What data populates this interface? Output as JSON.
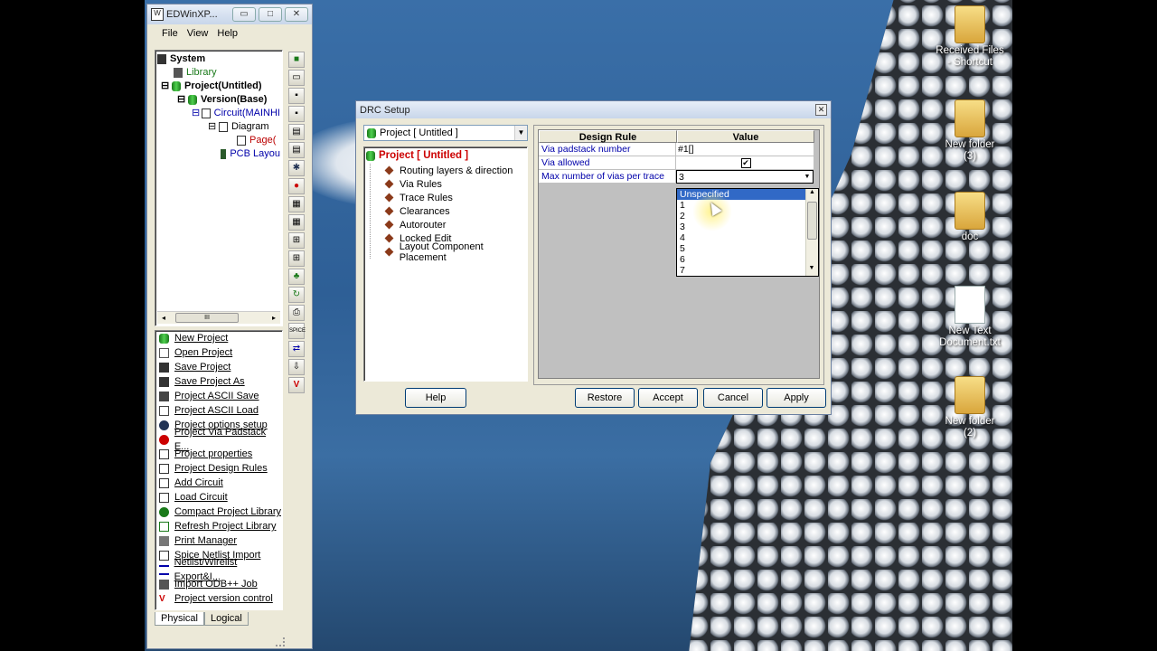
{
  "desktop": {
    "icons": [
      {
        "label_line1": "Received Files",
        "label_line2": "- Shortcut",
        "icon": "folder-shortcut-icon"
      },
      {
        "label_line1": "New folder",
        "label_line2": "(3)",
        "icon": "folder-icon"
      },
      {
        "label_line1": "doc",
        "label_line2": "",
        "icon": "folder-icon"
      },
      {
        "label_line1": "New Text",
        "label_line2": "Document.txt",
        "icon": "text-document-icon"
      },
      {
        "label_line1": "New folder",
        "label_line2": "(2)",
        "icon": "folder-icon"
      }
    ]
  },
  "main_window": {
    "title": "EDWinXP...",
    "controls": {
      "minimize": "▭",
      "maximize": "□",
      "close": "✕"
    },
    "menu": [
      "File",
      "View",
      "Help"
    ],
    "tree": {
      "system": "System",
      "library": "Library",
      "project": "Project(Untitled)",
      "version": "Version(Base)",
      "circuit": "Circuit(MAINHI",
      "diagram": "Diagram",
      "page": "Page(",
      "pcb": "PCB Layou",
      "hscroll_thumb": "III"
    },
    "actions": [
      "New Project",
      "Open Project",
      "Save Project",
      "Save Project As",
      "Project ASCII Save",
      "Project ASCII Load",
      "Project options setup",
      "Project Via Padstack E...",
      "Project properties",
      "Project Design Rules",
      "Add Circuit",
      "Load Circuit",
      "Compact Project Library",
      "Refresh Project Library",
      "Print Manager",
      "Spice Netlist Import",
      "Netlist/Wirelist Export&I...",
      "Import ODB++ Job",
      "Project version control"
    ],
    "tabs": {
      "physical": "Physical",
      "logical": "Logical"
    },
    "toolbar_spice": "SPICE"
  },
  "drc_dialog": {
    "title": "DRC Setup",
    "close": "✕",
    "scope_select": "Project [ Untitled ]",
    "tree_root": "Project [ Untitled ]",
    "tree_items": [
      "Routing layers & direction",
      "Via Rules",
      "Trace Rules",
      "Clearances",
      "Autorouter",
      "Locked Edit",
      "Layout Component Placement"
    ],
    "grid": {
      "headers": {
        "rule": "Design Rule",
        "value": "Value"
      },
      "rows": [
        {
          "rule": "Via padstack number",
          "value": "#1[]"
        },
        {
          "rule": "Via allowed",
          "value": "✔"
        },
        {
          "rule": "Max number of vias per trace",
          "value": "3"
        }
      ]
    },
    "dropdown_options": [
      "Unspecified",
      "1",
      "2",
      "3",
      "4",
      "5",
      "6",
      "7"
    ],
    "buttons": {
      "help": "Help",
      "restore": "Restore",
      "accept": "Accept",
      "cancel": "Cancel",
      "apply": "Apply"
    }
  }
}
